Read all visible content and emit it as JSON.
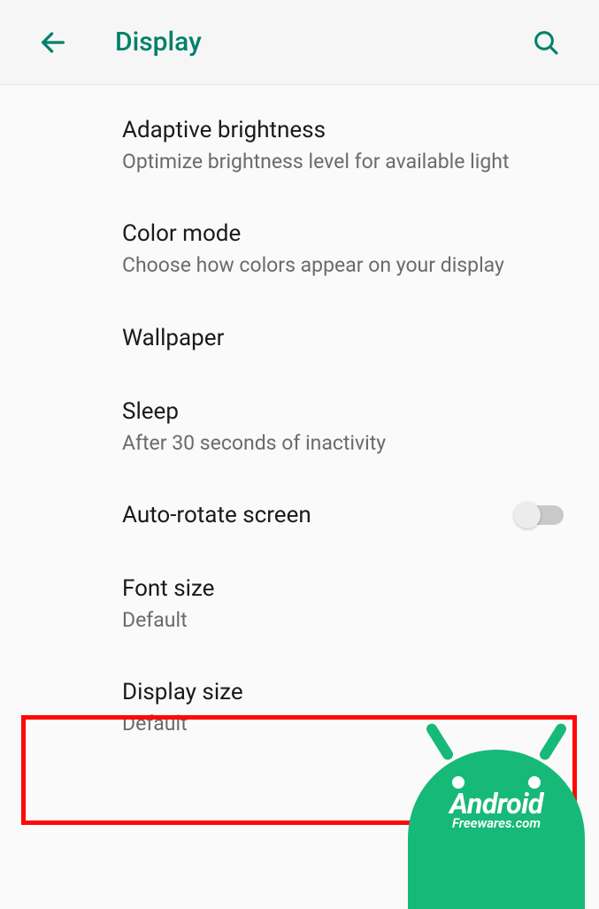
{
  "header": {
    "title": "Display"
  },
  "settings": [
    {
      "key": "adaptive-brightness",
      "title": "Adaptive brightness",
      "sub": "Optimize brightness level for available light"
    },
    {
      "key": "color-mode",
      "title": "Color mode",
      "sub": "Choose how colors appear on your display"
    },
    {
      "key": "wallpaper",
      "title": "Wallpaper",
      "sub": ""
    },
    {
      "key": "sleep",
      "title": "Sleep",
      "sub": "After 30 seconds of inactivity"
    },
    {
      "key": "auto-rotate",
      "title": "Auto-rotate screen",
      "sub": "",
      "toggle": false
    },
    {
      "key": "font-size",
      "title": "Font size",
      "sub": "Default"
    },
    {
      "key": "display-size",
      "title": "Display size",
      "sub": "Default"
    }
  ],
  "logo": {
    "line1": "Android",
    "line2": "Freewares.com"
  },
  "colors": {
    "accent": "#00806a",
    "highlight": "#ff0808",
    "logo": "#17b978"
  }
}
